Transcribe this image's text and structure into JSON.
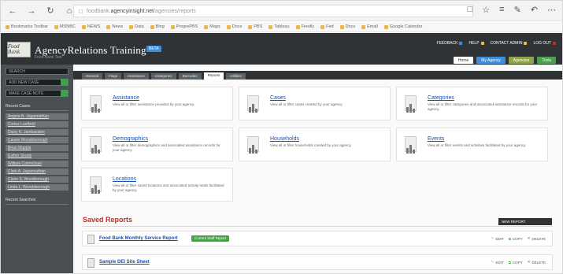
{
  "browser": {
    "url_domain": "agencyinsight.net",
    "url_prefix": "foodbank",
    "url_path": "/agencies/reports",
    "bookmarks": [
      "Bookmarks Toolbar",
      "MSNBC",
      "NEWS",
      "News",
      "Data",
      "Bing",
      "ProgrePBS",
      "Maps",
      "Docs",
      "PBS",
      "Tableau",
      "Feedly",
      "Fed",
      "Docs",
      "Email",
      "Google Calendar"
    ]
  },
  "app": {
    "title": "AgencyRelations Training",
    "subtitle": "Food Bank Test",
    "beta_label": "BETA",
    "logo_text": "Food Bank",
    "top_links": [
      "FEEDBACK",
      "HELP",
      "CONTACT ADMIN",
      "LOG OUT"
    ],
    "top_buttons": [
      "Home",
      "My Agency",
      "Agencies",
      "Tools"
    ],
    "colors": {
      "header": "#2f3336",
      "blue_btn": "#3f8ed9",
      "green_btn": "#4aa14e",
      "olive_btn": "#8ea34a",
      "red": "#c62b1f",
      "link": "#1a4fa8"
    }
  },
  "sidebar": {
    "search_placeholder": "SEARCH",
    "add_user_label": "ADD NEW CASE",
    "add_user2_label": "MAKE CASE NOTE",
    "recent_heading": "Recent Cases",
    "recent_cases": [
      "Angela B. Jagannathan",
      "Cortez Lustfield",
      "Daisy K. Jambavalee",
      "Cassie Woodsborough",
      "Brian Mapple",
      "Esther Shank",
      "William Carmichael",
      "Clark A. Jagannathan",
      "Claire S. Woodborough",
      "Linda L. Woodsborough"
    ],
    "recent_searches_heading": "Recent Searches"
  },
  "tabs": [
    "General",
    "Flags",
    "Assistance",
    "Categories",
    "Barcodes",
    "Reports",
    "Utilities"
  ],
  "active_tab": "Reports",
  "reports": [
    {
      "title": "Assistance",
      "desc": "View all or filter assistance provided by your agency."
    },
    {
      "title": "Cases",
      "desc": "View all or filter cases created by your agency."
    },
    {
      "title": "Categories",
      "desc": "View all or filter categories and associated assistance records for your agency."
    },
    {
      "title": "Demographics",
      "desc": "View all or filter demographics and associated assistance records for your agency."
    },
    {
      "title": "Households",
      "desc": "View all or filter households created by your agency."
    },
    {
      "title": "Events",
      "desc": "View all or filter events and activities facilitated by your agency."
    },
    {
      "title": "Locations",
      "desc": "View all or filter saved locations and associated activity totals facilitated by your agency."
    }
  ],
  "saved": {
    "heading": "Saved Reports",
    "button_label": "NEW REPORT",
    "rows": [
      {
        "name": "Food Bank Monthly Service Report",
        "badge": "Current Staff Report"
      },
      {
        "name": "Sample DEI Site Sheet",
        "badge": ""
      }
    ],
    "actions": [
      "EDIT",
      "COPY",
      "DELETE"
    ]
  }
}
